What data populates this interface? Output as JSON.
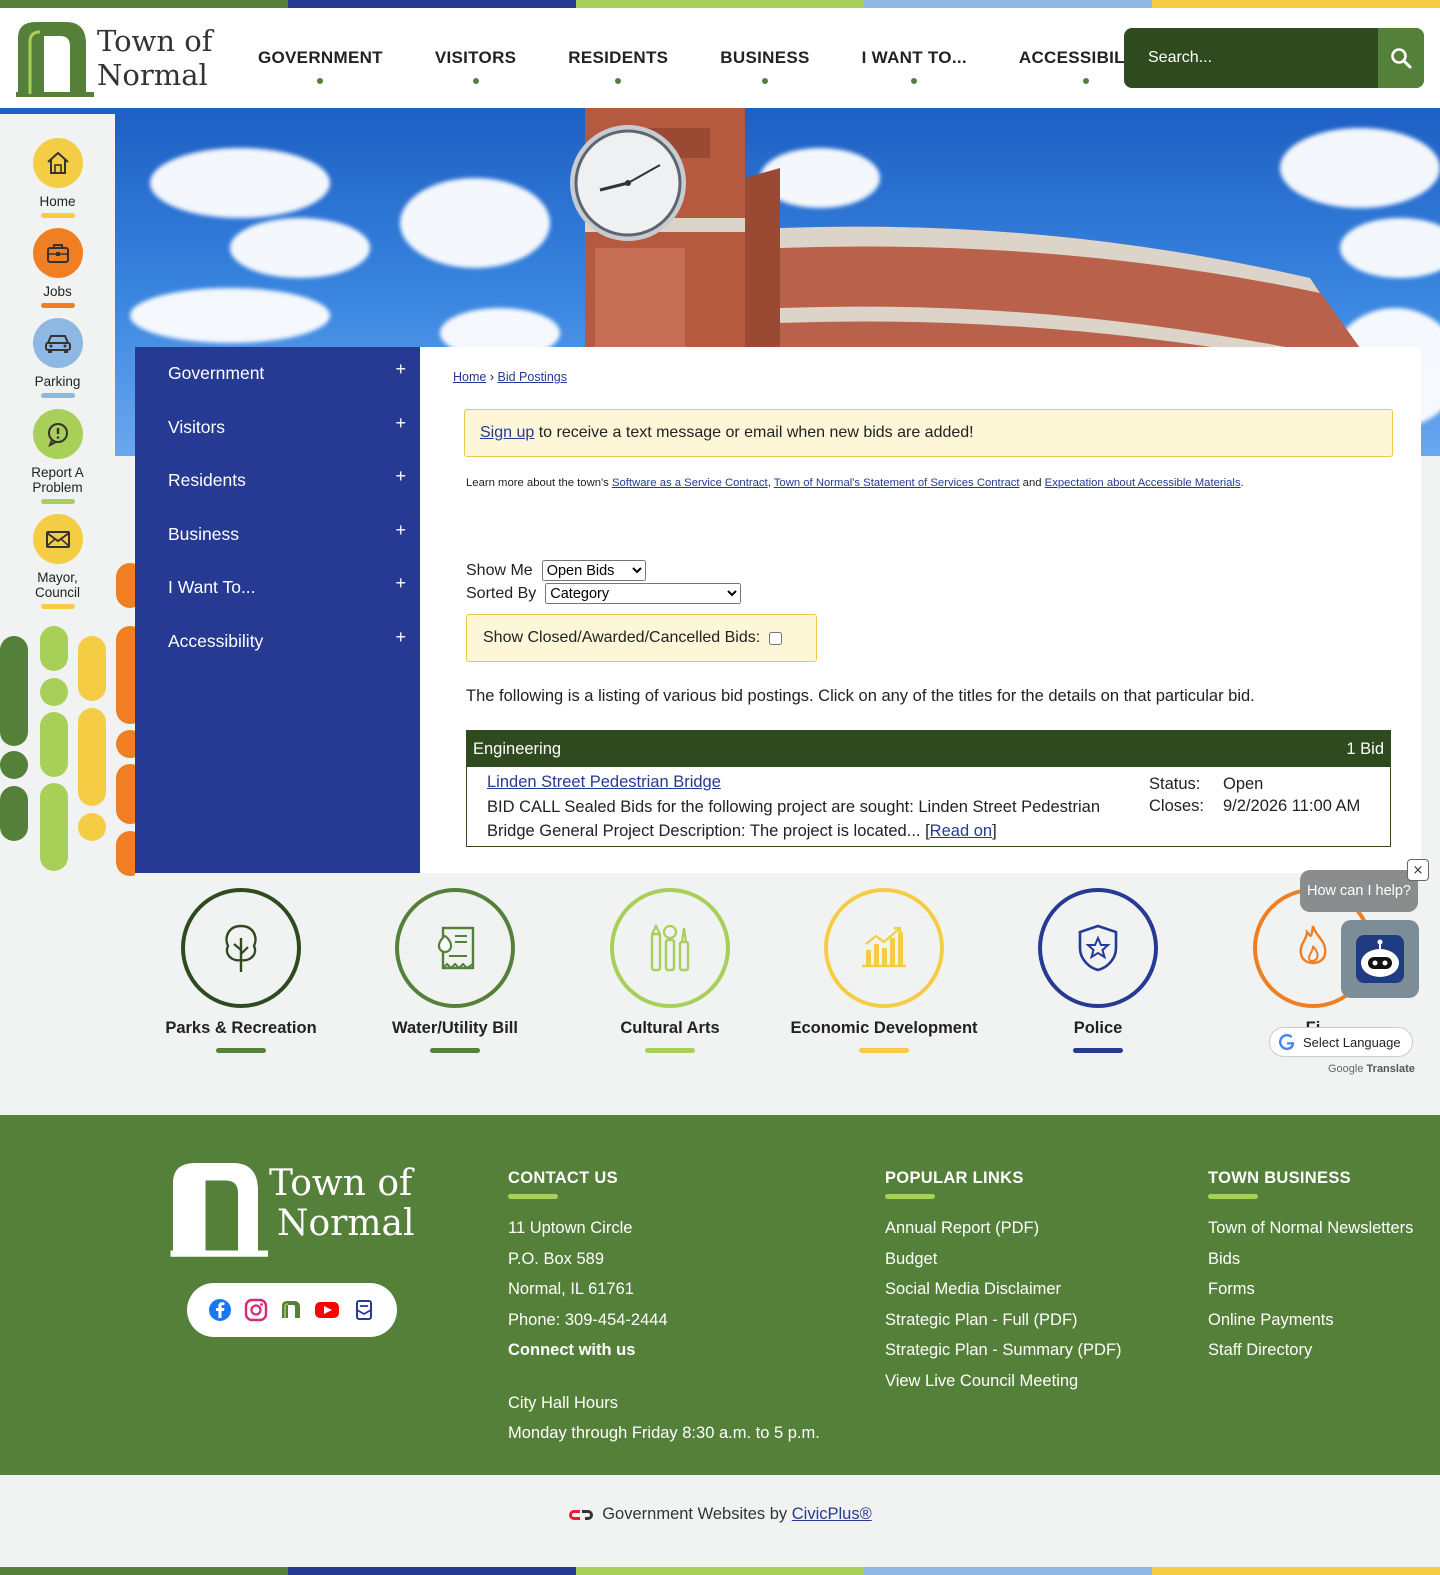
{
  "header": {
    "logo_line1": "Town of",
    "logo_line2": "Normal",
    "nav": [
      "GOVERNMENT",
      "VISITORS",
      "RESIDENTS",
      "BUSINESS",
      "I WANT TO...",
      "ACCESSIBILITY"
    ],
    "search_placeholder": "Search..."
  },
  "quicklinks": [
    {
      "label": "Home",
      "icon": "house-icon",
      "color": "#f5cd45",
      "bar": "#f5cd45"
    },
    {
      "label": "Jobs",
      "icon": "briefcase-icon",
      "color": "#ef7f22",
      "bar": "#ef7f22"
    },
    {
      "label": "Parking",
      "icon": "car-icon",
      "color": "#8fb7e3",
      "bar": "#8fb7e3"
    },
    {
      "label": "Report A Problem",
      "icon": "alert-icon",
      "color": "#a8cf58",
      "bar": "#a8cf58"
    },
    {
      "label": "Mayor, Council",
      "icon": "envelope-icon",
      "color": "#f5cd45",
      "bar": "#f5cd45"
    }
  ],
  "sidemenu": [
    "Government",
    "Visitors",
    "Residents",
    "Business",
    "I Want To...",
    "Accessibility"
  ],
  "breadcrumb": {
    "home": "Home",
    "sep": "›",
    "current": "Bid Postings"
  },
  "signup": {
    "link": "Sign up",
    "text": " to receive a text message or email when new bids are added!"
  },
  "learn": {
    "prefix": "Learn more about the town's ",
    "link1": "Software as a Service Contract",
    "comma": ", ",
    "link2": "Town of Normal's Statement of Services Contract",
    "and": " and ",
    "link3": "Expectation about Accessible Materials",
    "end": "."
  },
  "filters": {
    "show_me_label": "Show Me",
    "show_me_value": "Open Bids",
    "sorted_by_label": "Sorted By",
    "sorted_by_value": "Category",
    "closed_label": "Show Closed/Awarded/Cancelled Bids:"
  },
  "listing_intro": "The following is a listing of various bid postings. Click on any of the titles for the details on that particular bid.",
  "bid_category": {
    "name": "Engineering",
    "count": "1 Bid",
    "bid": {
      "title": "Linden Street Pedestrian Bridge",
      "description": "BID CALL Sealed Bids for the following project are sought: Linden Street Pedestrian Bridge General Project Description: The project is located...",
      "read_on_open": " [",
      "read_on": "Read on",
      "read_on_close": "]",
      "status_label": "Status:",
      "status": "Open",
      "closes_label": "Closes:",
      "closes": "9/2/2026 11:00 AM"
    }
  },
  "services": [
    {
      "label": "Parks & Recreation",
      "icon": "tree-icon",
      "color": "#2f4a1e"
    },
    {
      "label": "Water/Utility Bill",
      "icon": "water-bill-icon",
      "color": "#54803a"
    },
    {
      "label": "Cultural Arts",
      "icon": "art-supplies-icon",
      "color": "#a8cf58"
    },
    {
      "label": "Economic Development",
      "icon": "bar-chart-icon",
      "color": "#f5cd45"
    },
    {
      "label": "Police",
      "icon": "police-badge-icon",
      "color": "#263a93"
    },
    {
      "label": "Fi",
      "icon": "fire-icon",
      "color": "#ef7f22"
    }
  ],
  "chat": {
    "bubble": "How can I help?",
    "close": "×"
  },
  "translate": {
    "label": "Select Language",
    "powered": "Google",
    "translate": "Translate"
  },
  "footer": {
    "logo_line1": "Town of",
    "logo_line2": "Normal",
    "contact": {
      "heading": "CONTACT US",
      "lines": [
        "11 Uptown Circle",
        "P.O. Box 589",
        "Normal, IL 61761",
        "Phone: 309-454-2444"
      ],
      "connect": "Connect with us",
      "hours_title": "City Hall Hours",
      "hours": "Monday through Friday 8:30 a.m. to 5 p.m."
    },
    "popular": {
      "heading": "POPULAR LINKS",
      "links": [
        "Annual Report (PDF)",
        "Budget",
        "Social Media Disclaimer",
        "Strategic Plan - Full (PDF)",
        "Strategic Plan - Summary (PDF)",
        "View Live Council Meeting"
      ]
    },
    "business": {
      "heading": "TOWN BUSINESS",
      "links": [
        "Town of Normal Newsletters",
        "Bids",
        "Forms",
        "Online Payments",
        "Staff Directory"
      ]
    }
  },
  "civic": {
    "text": "Government Websites by ",
    "link": "CivicPlus®"
  },
  "colors": {
    "green": "#54803a",
    "dark_green": "#2f4a1e",
    "blue": "#263a93",
    "lime": "#a8cf58",
    "yellow": "#f5cd45",
    "orange": "#ef7f22",
    "sky": "#8fb7e3"
  }
}
